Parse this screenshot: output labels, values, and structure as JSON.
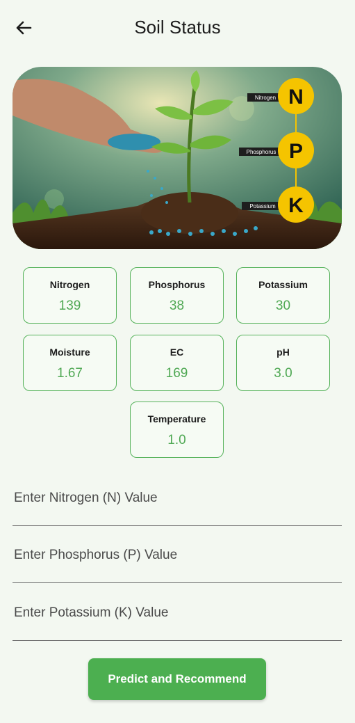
{
  "appbar": {
    "title": "Soil Status",
    "back_icon": "arrow-left-icon"
  },
  "hero": {
    "labels": {
      "n_caption": "Nitrogen",
      "p_caption": "Phosphorus",
      "k_caption": "Potassium",
      "n_letter": "N",
      "p_letter": "P",
      "k_letter": "K"
    },
    "colors": {
      "badge": "#f5c400",
      "sky": "#2d6f5e",
      "soil": "#3b2416"
    }
  },
  "metrics": [
    {
      "label": "Nitrogen",
      "value": "139"
    },
    {
      "label": "Phosphorus",
      "value": "38"
    },
    {
      "label": "Potassium",
      "value": "30"
    },
    {
      "label": "Moisture",
      "value": "1.67"
    },
    {
      "label": "EC",
      "value": "169"
    },
    {
      "label": "pH",
      "value": "3.0"
    },
    {
      "label": "Temperature",
      "value": "1.0"
    }
  ],
  "inputs": {
    "nitrogen": {
      "placeholder": "Enter Nitrogen (N) Value",
      "value": ""
    },
    "phosphorus": {
      "placeholder": "Enter Phosphorus (P) Value",
      "value": ""
    },
    "potassium": {
      "placeholder": "Enter Potassium (K) Value",
      "value": ""
    }
  },
  "button": {
    "label": "Predict and Recommend"
  },
  "theme": {
    "accent": "#4caf50",
    "card_border": "#55b25a",
    "value_text": "#4fa853"
  }
}
